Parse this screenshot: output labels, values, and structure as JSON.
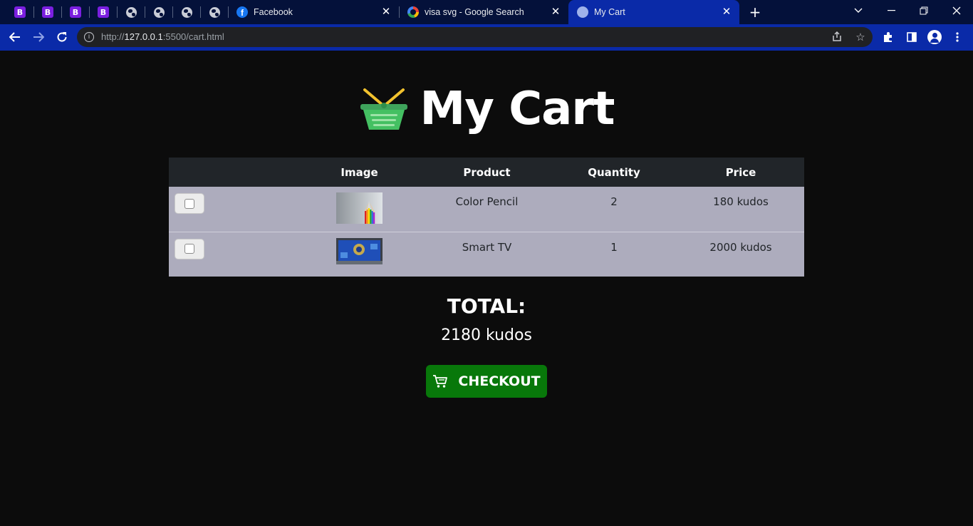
{
  "browser": {
    "pinned_tabs": [
      {
        "icon": "bootstrap-icon",
        "label": "B"
      },
      {
        "icon": "bootstrap-icon",
        "label": "B"
      },
      {
        "icon": "bootstrap-icon",
        "label": "B"
      },
      {
        "icon": "bootstrap-icon",
        "label": "B"
      },
      {
        "icon": "globe-icon"
      },
      {
        "icon": "globe-icon"
      },
      {
        "icon": "globe-icon"
      },
      {
        "icon": "globe-icon"
      }
    ],
    "tabs": [
      {
        "title": "Facebook",
        "icon": "facebook-icon"
      },
      {
        "title": "visa svg - Google Search",
        "icon": "google-icon"
      },
      {
        "title": "My Cart",
        "icon": "globe-icon",
        "active": true
      }
    ],
    "url_prefix": "http://",
    "url_host": "127.0.0.1",
    "url_rest": ":5500/cart.html"
  },
  "page": {
    "title": "My Cart",
    "table": {
      "headers": [
        "",
        "Image",
        "Product",
        "Quantity",
        "Price"
      ],
      "rows": [
        {
          "product": "Color Pencil",
          "quantity": "2",
          "price": "180 kudos",
          "image": "color-pencil-thumbnail"
        },
        {
          "product": "Smart TV",
          "quantity": "1",
          "price": "2000 kudos",
          "image": "smart-tv-thumbnail"
        }
      ]
    },
    "total_label": "TOTAL:",
    "total_value": "2180 kudos",
    "checkout_label": "CHECKOUT"
  },
  "colors": {
    "page_bg": "#0c0c0c",
    "table_header_bg": "#212529",
    "table_row_bg": "#adacbd",
    "checkout_bg": "#08780a",
    "tab_strip_bg": "#04113a",
    "toolbar_bg": "#0a2aa8"
  }
}
